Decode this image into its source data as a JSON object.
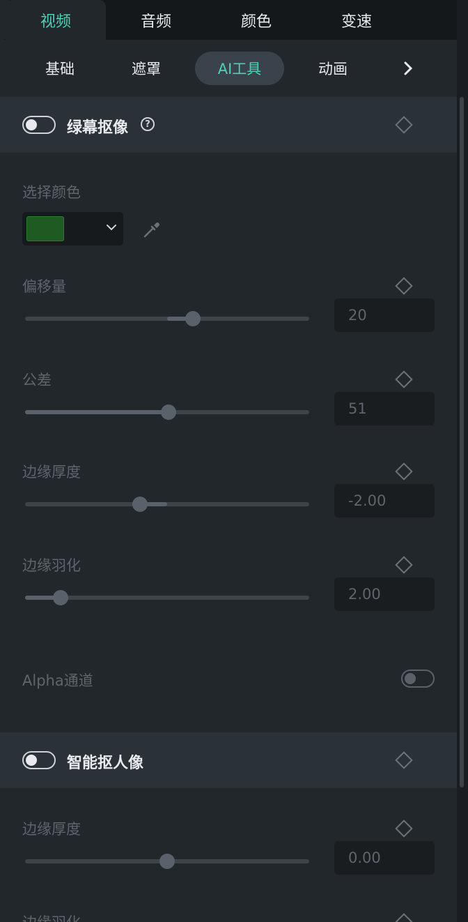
{
  "top_tabs": [
    {
      "label": "视频",
      "active": true
    },
    {
      "label": "音频",
      "active": false
    },
    {
      "label": "颜色",
      "active": false
    },
    {
      "label": "变速",
      "active": false
    }
  ],
  "sub_tabs": [
    {
      "label": "基础",
      "active": false
    },
    {
      "label": "遮罩",
      "active": false
    },
    {
      "label": "AI工具",
      "active": true
    },
    {
      "label": "动画",
      "active": false
    }
  ],
  "colors": {
    "accent": "#4fd1b8",
    "selected_color": "#1e5a22"
  },
  "chroma_key": {
    "title": "绿幕抠像",
    "enabled": false,
    "select_color_label": "选择颜色",
    "sliders": [
      {
        "label": "偏移量",
        "value": "20",
        "position": 0.59,
        "mode": "center"
      },
      {
        "label": "公差",
        "value": "51",
        "position": 0.505,
        "mode": "left"
      },
      {
        "label": "边缘厚度",
        "value": "-2.00",
        "position": 0.405,
        "mode": "center"
      },
      {
        "label": "边缘羽化",
        "value": "2.00",
        "position": 0.125,
        "mode": "left"
      }
    ],
    "alpha_label": "Alpha通道",
    "alpha_enabled": false
  },
  "smart_cutout": {
    "title": "智能抠人像",
    "enabled": false,
    "sliders": [
      {
        "label": "边缘厚度",
        "value": "0.00",
        "position": 0.5,
        "mode": "center"
      }
    ],
    "next_label": "边缘羽化"
  }
}
